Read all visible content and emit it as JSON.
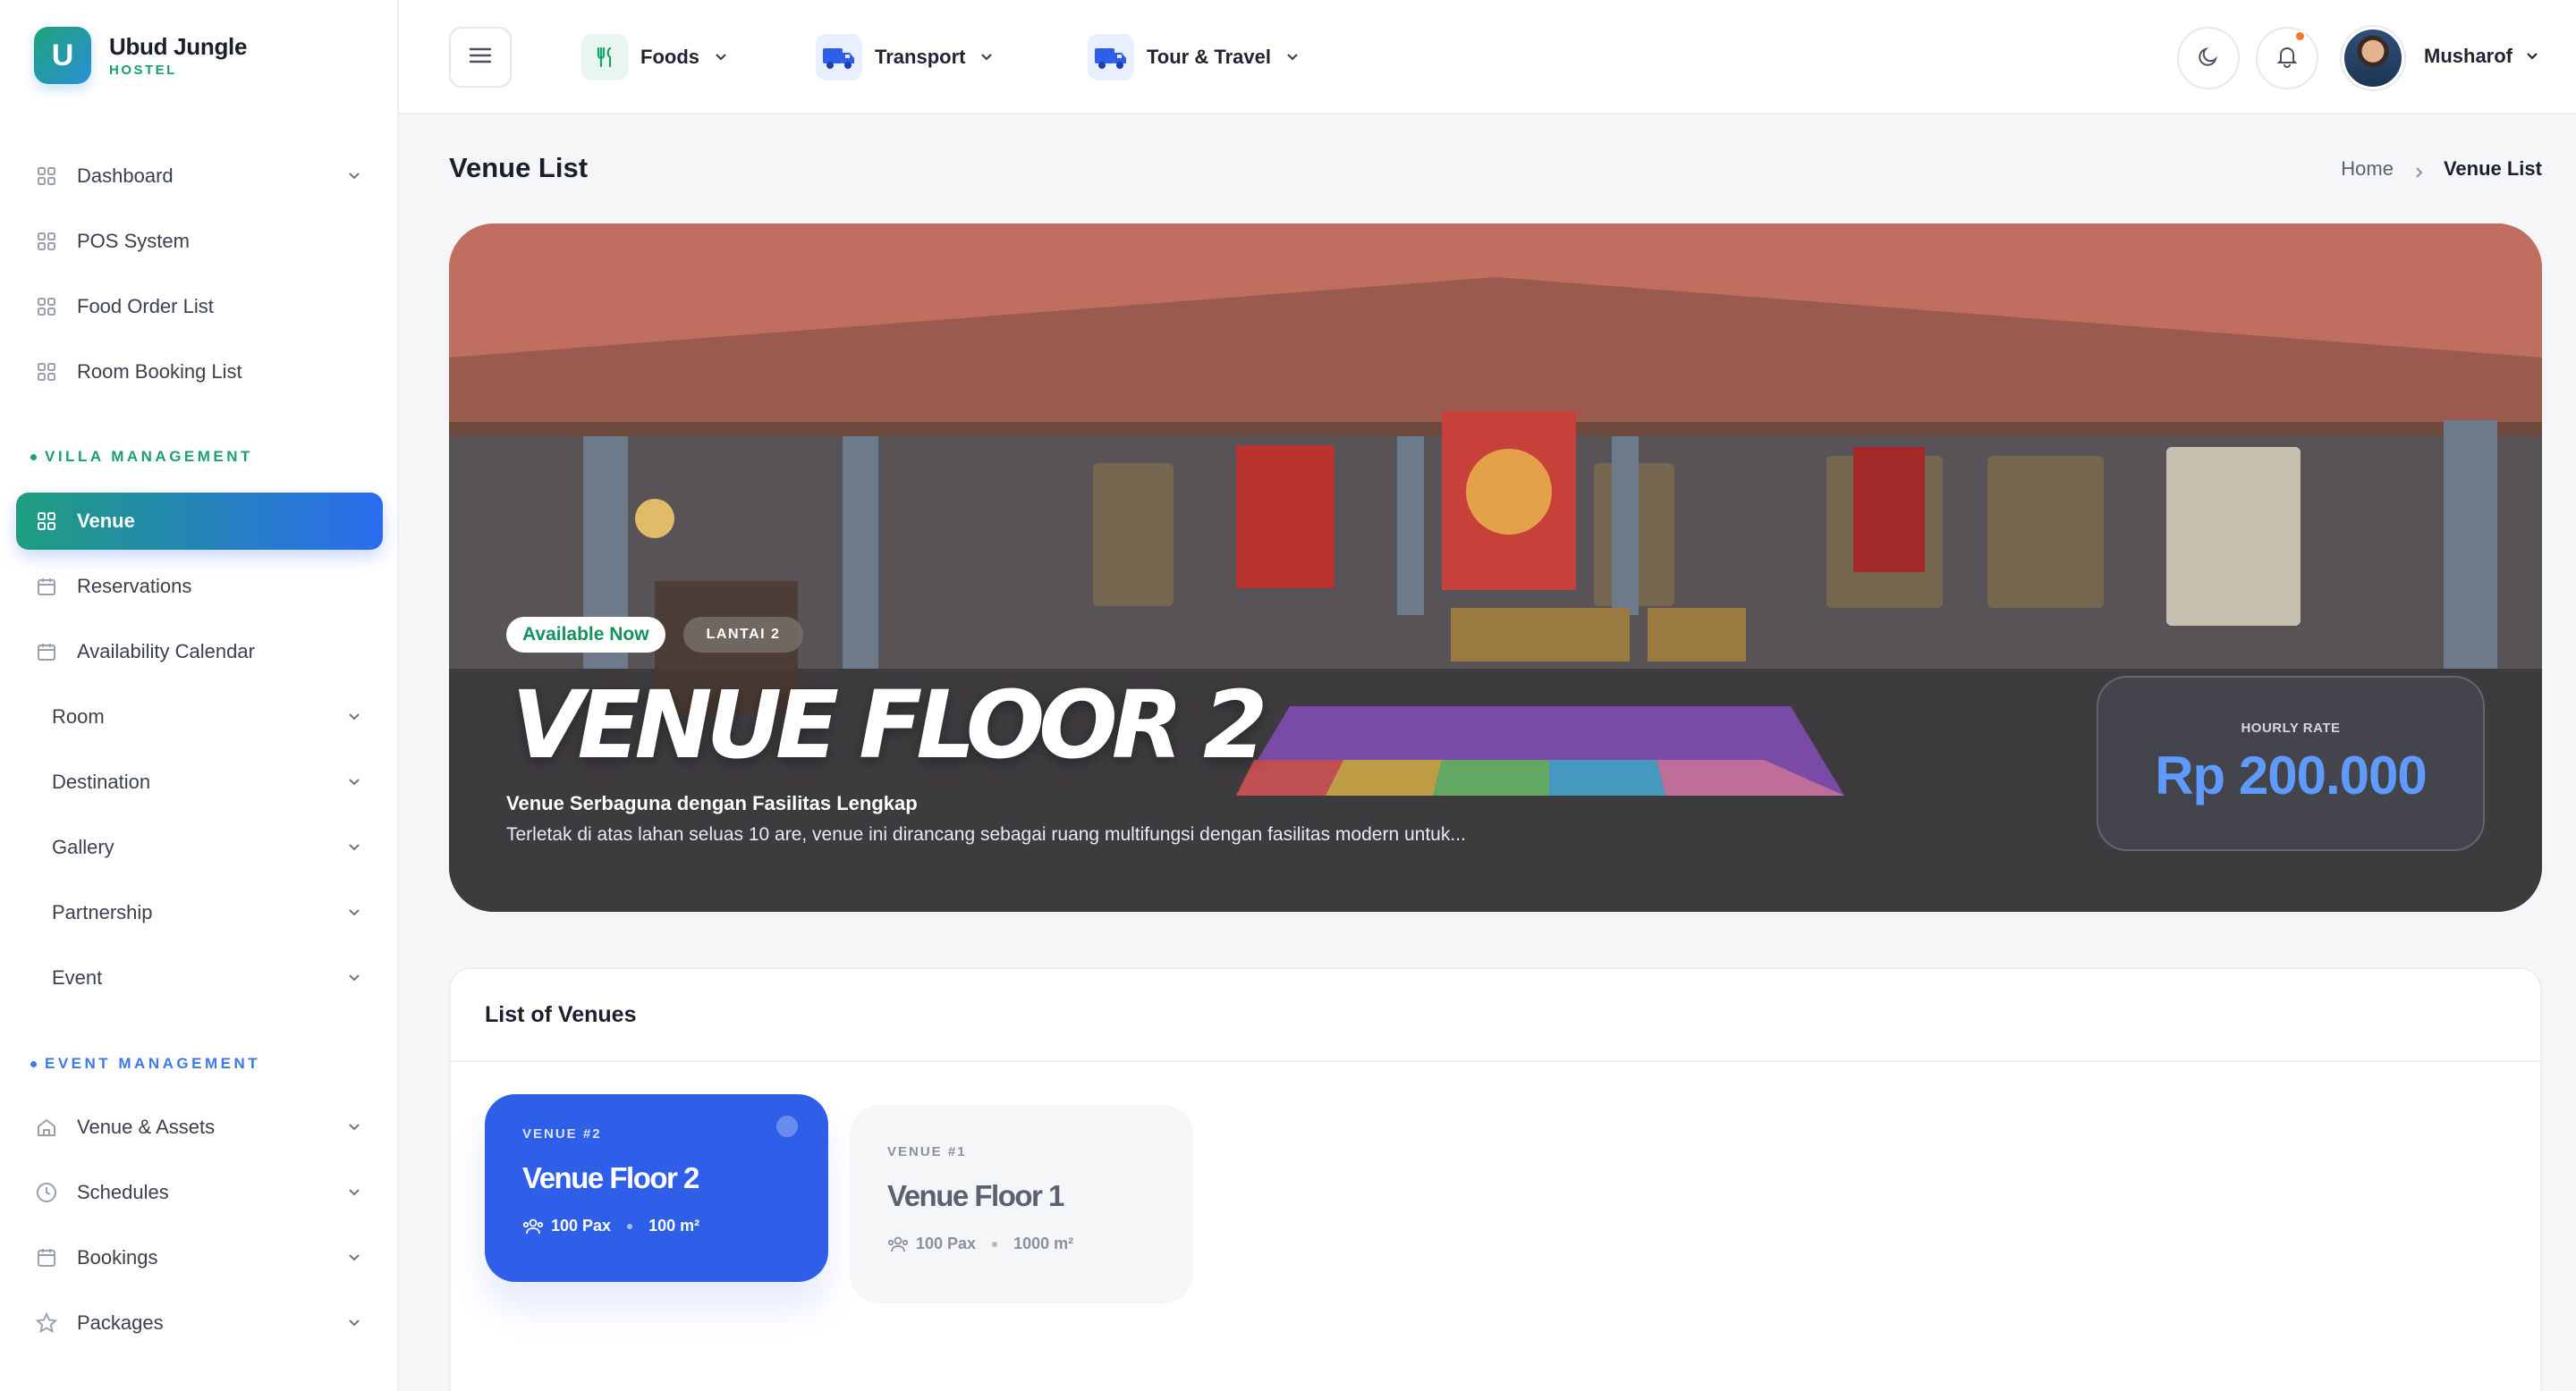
{
  "brand": {
    "initial": "U",
    "name": "Ubud Jungle",
    "sub": "HOSTEL"
  },
  "sidebar": {
    "items_top": [
      {
        "label": "Dashboard",
        "icon": "grid-icon",
        "chevron": true
      },
      {
        "label": "POS System",
        "icon": "grid-icon",
        "chevron": false
      },
      {
        "label": "Food Order List",
        "icon": "grid-icon",
        "chevron": false
      },
      {
        "label": "Room Booking List",
        "icon": "grid-icon",
        "chevron": false
      }
    ],
    "villa_section": "VILLA MANAGEMENT",
    "villa_items": [
      {
        "label": "Venue",
        "icon": "grid-icon",
        "active": true
      },
      {
        "label": "Reservations",
        "icon": "calendar-icon"
      },
      {
        "label": "Availability Calendar",
        "icon": "calendar-icon"
      },
      {
        "label": "Room",
        "chevron": true
      },
      {
        "label": "Destination",
        "chevron": true
      },
      {
        "label": "Gallery",
        "chevron": true
      },
      {
        "label": "Partnership",
        "chevron": true
      },
      {
        "label": "Event",
        "chevron": true
      }
    ],
    "event_section": "EVENT MANAGEMENT",
    "event_items": [
      {
        "label": "Venue & Assets",
        "icon": "home-icon",
        "chevron": true
      },
      {
        "label": "Schedules",
        "icon": "clock-icon",
        "chevron": true
      },
      {
        "label": "Bookings",
        "icon": "calendar-icon",
        "chevron": true
      },
      {
        "label": "Packages",
        "icon": "star-icon",
        "chevron": true
      }
    ]
  },
  "topbar": {
    "menus": [
      {
        "label": "Foods",
        "icon": "fork-knife-icon",
        "icon_bg": "#e8f6ef",
        "icon_color": "#1aa06d"
      },
      {
        "label": "Transport",
        "icon": "truck-icon",
        "icon_bg": "#e9efff",
        "icon_color": "#2f5fe8"
      },
      {
        "label": "Tour & Travel",
        "icon": "truck-icon",
        "icon_bg": "#e9efff",
        "icon_color": "#2f5fe8"
      }
    ],
    "user_name": "Musharof"
  },
  "page": {
    "title": "Venue List",
    "breadcrumb": {
      "home": "Home",
      "current": "Venue List"
    }
  },
  "hero": {
    "badge_status": "Available Now",
    "badge_floor": "LANTAI 2",
    "title": "VENUE FLOOR 2",
    "subtitle": "Venue Serbaguna dengan Fasilitas Lengkap",
    "description": "Terletak di atas lahan seluas 10 are, venue ini dirancang sebagai ruang multifungsi dengan fasilitas modern untuk...",
    "rate_label": "HOURLY RATE",
    "rate_value": "Rp 200.000"
  },
  "venues": {
    "heading": "List of Venues",
    "cards": [
      {
        "number": "VENUE #2",
        "name": "Venue Floor 2",
        "pax": "100 Pax",
        "area": "100 m²",
        "selected": true
      },
      {
        "number": "VENUE #1",
        "name": "Venue Floor 1",
        "pax": "100 Pax",
        "area": "1000 m²",
        "selected": false
      }
    ]
  },
  "colors": {
    "accent": "#2f5fe8",
    "green": "#1aa06d",
    "notif": "#f07a2c"
  }
}
